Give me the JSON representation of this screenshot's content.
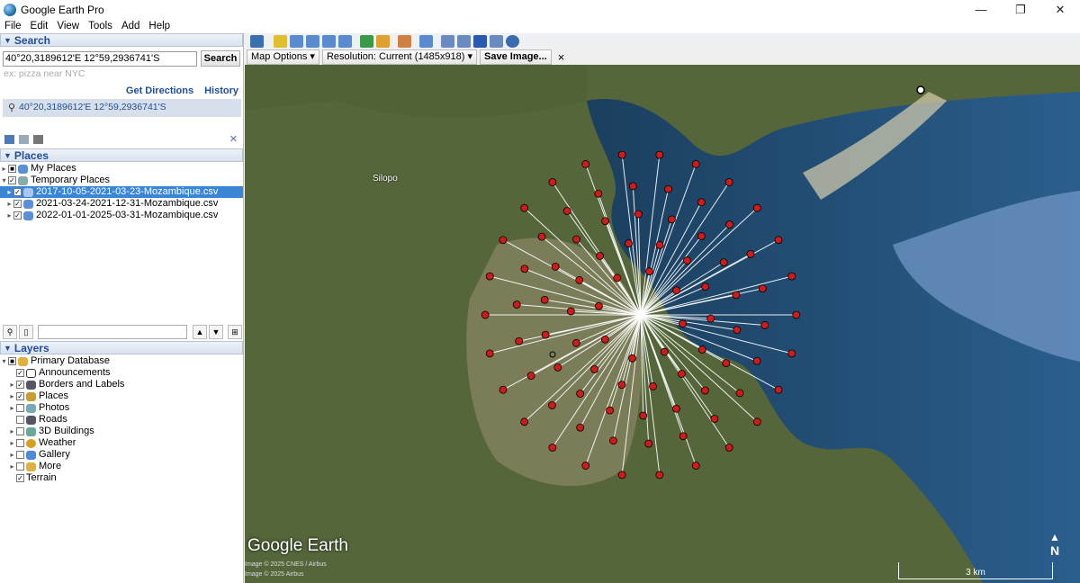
{
  "window": {
    "title": "Google Earth Pro",
    "controls": [
      "—",
      "❐",
      "✕"
    ]
  },
  "menu": [
    "File",
    "Edit",
    "View",
    "Tools",
    "Add",
    "Help"
  ],
  "search": {
    "header": "Search",
    "query": "40°20,3189612'E 12°59,2936741'S",
    "button": "Search",
    "placeholder": "ex: pizza near NYC",
    "get_directions": "Get Directions",
    "history": "History",
    "result": "40°20,3189612'E 12°59,2936741'S"
  },
  "places": {
    "header": "Places",
    "items": [
      {
        "label": "My Places"
      },
      {
        "label": "Temporary Places"
      },
      {
        "label": "2017-10-05-2021-03-23-Mozambique.csv",
        "selected": true
      },
      {
        "label": "2021-03-24-2021-12-31-Mozambique.csv"
      },
      {
        "label": "2022-01-01-2025-03-31-Mozambique.csv"
      }
    ]
  },
  "layers": {
    "header": "Layers",
    "root": "Primary Database",
    "items": [
      {
        "label": "Announcements",
        "checked": true
      },
      {
        "label": "Borders and Labels",
        "checked": true
      },
      {
        "label": "Places",
        "checked": true
      },
      {
        "label": "Photos",
        "checked": false
      },
      {
        "label": "Roads",
        "checked": false
      },
      {
        "label": "3D Buildings",
        "checked": false
      },
      {
        "label": "Weather",
        "checked": false
      },
      {
        "label": "Gallery",
        "checked": false
      },
      {
        "label": "More",
        "checked": false
      },
      {
        "label": "Terrain",
        "checked": true
      }
    ]
  },
  "print_toolbar": {
    "map_options": "Map Options",
    "resolution": "Resolution: Current (1485x918)",
    "save": "Save Image...",
    "close": "×"
  },
  "map": {
    "place_label": "Silopo",
    "logo": "Google Earth",
    "credit1": "Image © 2025 CNES / Airbus",
    "credit2": "Image © 2025 Airbus",
    "scale": "3 km",
    "north": "N",
    "colors": {
      "pin": "#d11a1a",
      "line": "#ffffff",
      "water": "#1f4d7a",
      "land": "#5a6b3c"
    }
  }
}
